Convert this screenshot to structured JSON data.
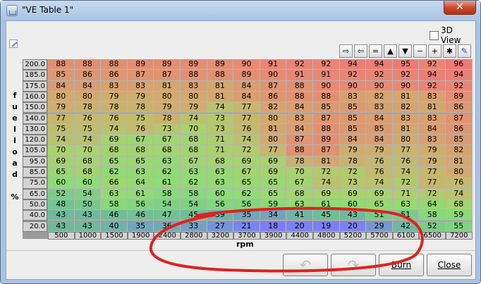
{
  "window": {
    "title": "\"VE Table 1\"",
    "close_glyph": "✕"
  },
  "view3d": {
    "label": "3D View",
    "checked": false
  },
  "toolbar": [
    {
      "name": "move-right-button",
      "glyph": "⇨"
    },
    {
      "name": "move-left-button",
      "glyph": "⇦"
    },
    {
      "name": "set-equal-button",
      "glyph": "="
    },
    {
      "name": "increase-button",
      "glyph": "▲"
    },
    {
      "name": "decrease-button",
      "glyph": "▼"
    },
    {
      "name": "subtract-button",
      "glyph": "−"
    },
    {
      "name": "add-button",
      "glyph": "+"
    },
    {
      "name": "multiply-button",
      "glyph": "✱"
    },
    {
      "name": "pen-button",
      "glyph": "✎"
    }
  ],
  "y_axis_letters": [
    "f",
    "u",
    "e",
    "l",
    "l",
    "o",
    "a",
    "d",
    "",
    "%"
  ],
  "x_axis_label": "rpm",
  "rpm": [
    "500",
    "1000",
    "1500",
    "1900",
    "2400",
    "2800",
    "3200",
    "3700",
    "3900",
    "4400",
    "4800",
    "5200",
    "5700",
    "6100",
    "6500",
    "7200"
  ],
  "load": [
    "200.0",
    "185.0",
    "175.0",
    "160.0",
    "150.0",
    "140.0",
    "130.0",
    "120.0",
    "105.0",
    "95.0",
    "85.0",
    "75.0",
    "65.0",
    "50.0",
    "40.0",
    "20.0"
  ],
  "table": [
    [
      88,
      88,
      88,
      89,
      89,
      89,
      89,
      90,
      91,
      92,
      92,
      94,
      94,
      95,
      92,
      96
    ],
    [
      85,
      86,
      86,
      87,
      87,
      88,
      88,
      89,
      90,
      91,
      91,
      92,
      92,
      92,
      94,
      94
    ],
    [
      84,
      84,
      83,
      83,
      81,
      83,
      81,
      84,
      87,
      88,
      90,
      90,
      90,
      90,
      92,
      92
    ],
    [
      80,
      80,
      79,
      79,
      80,
      80,
      81,
      84,
      86,
      88,
      88,
      83,
      82,
      81,
      83,
      89
    ],
    [
      79,
      78,
      78,
      78,
      79,
      79,
      74,
      77,
      82,
      84,
      85,
      85,
      83,
      82,
      81,
      86
    ],
    [
      77,
      76,
      76,
      75,
      78,
      74,
      73,
      77,
      80,
      83,
      87,
      85,
      84,
      83,
      83,
      87
    ],
    [
      75,
      75,
      74,
      76,
      73,
      70,
      73,
      76,
      81,
      84,
      88,
      85,
      85,
      81,
      84,
      86
    ],
    [
      74,
      74,
      69,
      67,
      67,
      68,
      71,
      74,
      80,
      87,
      89,
      84,
      84,
      80,
      83,
      85
    ],
    [
      70,
      70,
      68,
      68,
      68,
      68,
      71,
      72,
      77,
      88,
      87,
      79,
      79,
      77,
      79,
      82
    ],
    [
      69,
      68,
      65,
      65,
      63,
      67,
      68,
      69,
      69,
      78,
      81,
      78,
      76,
      76,
      79,
      81
    ],
    [
      65,
      68,
      62,
      63,
      62,
      63,
      63,
      67,
      69,
      70,
      72,
      72,
      76,
      74,
      77,
      80
    ],
    [
      60,
      60,
      66,
      64,
      61,
      62,
      63,
      65,
      65,
      67,
      74,
      73,
      74,
      72,
      77,
      76
    ],
    [
      52,
      54,
      63,
      61,
      58,
      58,
      60,
      62,
      65,
      68,
      69,
      69,
      69,
      71,
      72,
      74
    ],
    [
      48,
      50,
      58,
      56,
      54,
      54,
      56,
      56,
      59,
      63,
      61,
      60,
      65,
      63,
      64,
      68
    ],
    [
      43,
      43,
      46,
      46,
      47,
      45,
      39,
      35,
      34,
      41,
      45,
      43,
      51,
      51,
      58,
      59
    ],
    [
      43,
      43,
      40,
      35,
      36,
      33,
      27,
      21,
      18,
      20,
      19,
      20,
      29,
      42,
      52,
      55
    ]
  ],
  "buttons": {
    "undo_glyph": "↶",
    "redo_glyph": "↷",
    "burn": "Burn",
    "close": "Close"
  },
  "colors": {
    "high": "#e9837a",
    "mid": "#8ad97e",
    "low": "#7f86ec",
    "annotation": "#e0211c"
  }
}
